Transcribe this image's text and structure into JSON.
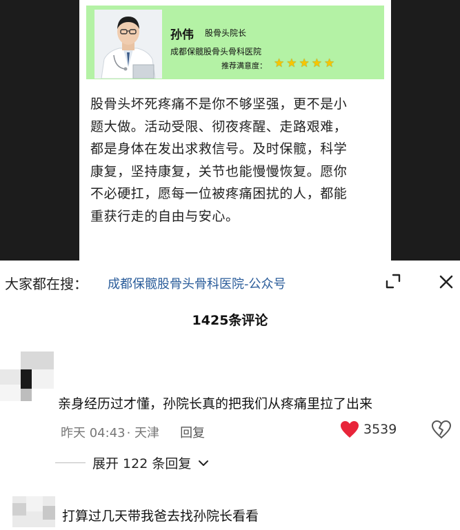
{
  "post": {
    "doctor_name": "孙伟",
    "doctor_title": "股骨头院长",
    "hospital": "成都保髋股骨头骨科医院",
    "rating_label": "推荐满意度：",
    "rating_stars": 5,
    "body_lines": [
      "股骨头坏死疼痛不是你不够坚强，更不是小",
      "题大做。活动受限、彻夜疼醒、走路艰难，",
      "都是身体在发出求救信号。及时保髋，科学",
      "康复，坚持康复，关节也能慢慢恢复。愿你",
      "不必硬扛，愿每一位被疼痛困扰的人，都能",
      "重获行走的自由与安心。"
    ]
  },
  "search": {
    "prefix": "大家都在搜：",
    "link": "成都保髋股骨头骨科医院-公众号"
  },
  "comments_header": {
    "count_label": "1425条评论"
  },
  "comments": [
    {
      "text": "亲身经历过才懂，孙院长真的把我们从疼痛里拉了出来",
      "time": "昨天 04:43",
      "location": "· 天津",
      "reply_label": "回复",
      "likes": "3539",
      "expand_label": "展开 122 条回复"
    },
    {
      "text": "打算过几天带我爸去找孙院长看看"
    }
  ],
  "colors": {
    "card_bg": "#b4f2a5",
    "star": "#f7c600",
    "link": "#2a5c9a",
    "heart": "#e8253a"
  },
  "icons": {
    "expand": "expand-icon",
    "close": "close-icon",
    "like": "heart-icon",
    "dislike": "broken-heart-icon",
    "chevron": "chevron-down-icon"
  }
}
